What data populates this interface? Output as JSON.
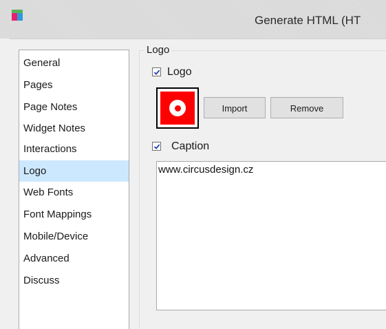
{
  "window": {
    "title": "Generate HTML (HT",
    "icon": "app-icon"
  },
  "nav": {
    "selected_index": 5,
    "items": [
      {
        "label": "General"
      },
      {
        "label": "Pages"
      },
      {
        "label": "Page Notes"
      },
      {
        "label": "Widget Notes"
      },
      {
        "label": "Interactions"
      },
      {
        "label": "Logo"
      },
      {
        "label": "Web Fonts"
      },
      {
        "label": "Font Mappings"
      },
      {
        "label": "Mobile/Device"
      },
      {
        "label": "Advanced"
      },
      {
        "label": "Discuss"
      }
    ]
  },
  "logo_group": {
    "title": "Logo",
    "logo_checkbox": {
      "label": "Logo",
      "checked": true
    },
    "logo_image": "circle-logo",
    "import_label": "Import",
    "remove_label": "Remove",
    "caption_checkbox": {
      "label": "Caption",
      "checked": true
    },
    "caption_text": "www.circusdesign.cz"
  },
  "colors": {
    "selection": "#cce8ff",
    "logo_red": "#ff0000",
    "check_blue": "#1f3fa8"
  }
}
